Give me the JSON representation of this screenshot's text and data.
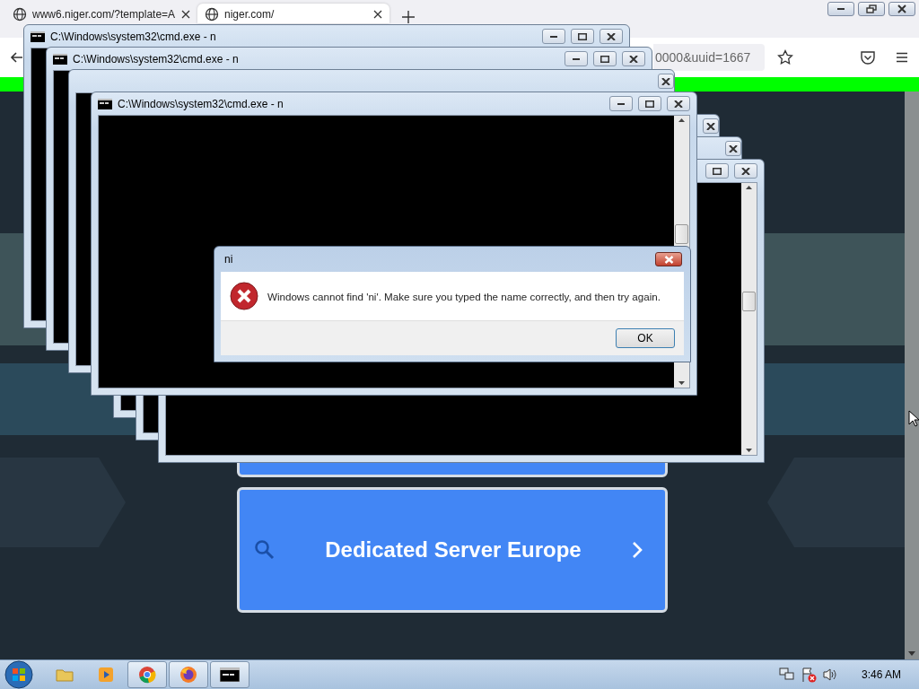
{
  "browser": {
    "tabs": [
      {
        "label": "www6.niger.com/?template=A",
        "selected": false
      },
      {
        "label": "niger.com/",
        "selected": true
      }
    ],
    "address": {
      "value": "0000&uuid=1667"
    }
  },
  "page": {
    "cards": [
      {
        "kind": "hidden"
      },
      {
        "kind": "label",
        "label": "Dedicated Server Europe"
      }
    ]
  },
  "cmd_windows": [
    {
      "kind": "full",
      "title": "C:\\Windows\\system32\\cmd.exe - n"
    },
    {
      "kind": "full",
      "title": "C:\\Windows\\system32\\cmd.exe - n"
    },
    {
      "kind": "covered"
    },
    {
      "kind": "covered"
    },
    {
      "kind": "covered"
    },
    {
      "kind": "partial"
    },
    {
      "kind": "front",
      "title": "C:\\Windows\\system32\\cmd.exe - n"
    }
  ],
  "dialog": {
    "title": "ni",
    "message": "Windows cannot find 'ni'. Make sure you typed the name correctly, and then try again.",
    "button": "OK"
  },
  "taskbar": {
    "apps": [
      {
        "kind": "folder",
        "running": false
      },
      {
        "kind": "media",
        "running": false
      },
      {
        "kind": "chrome",
        "running": true
      },
      {
        "kind": "firefox",
        "running": true
      },
      {
        "kind": "console",
        "running": true
      }
    ],
    "clock": "3:46 AM"
  }
}
